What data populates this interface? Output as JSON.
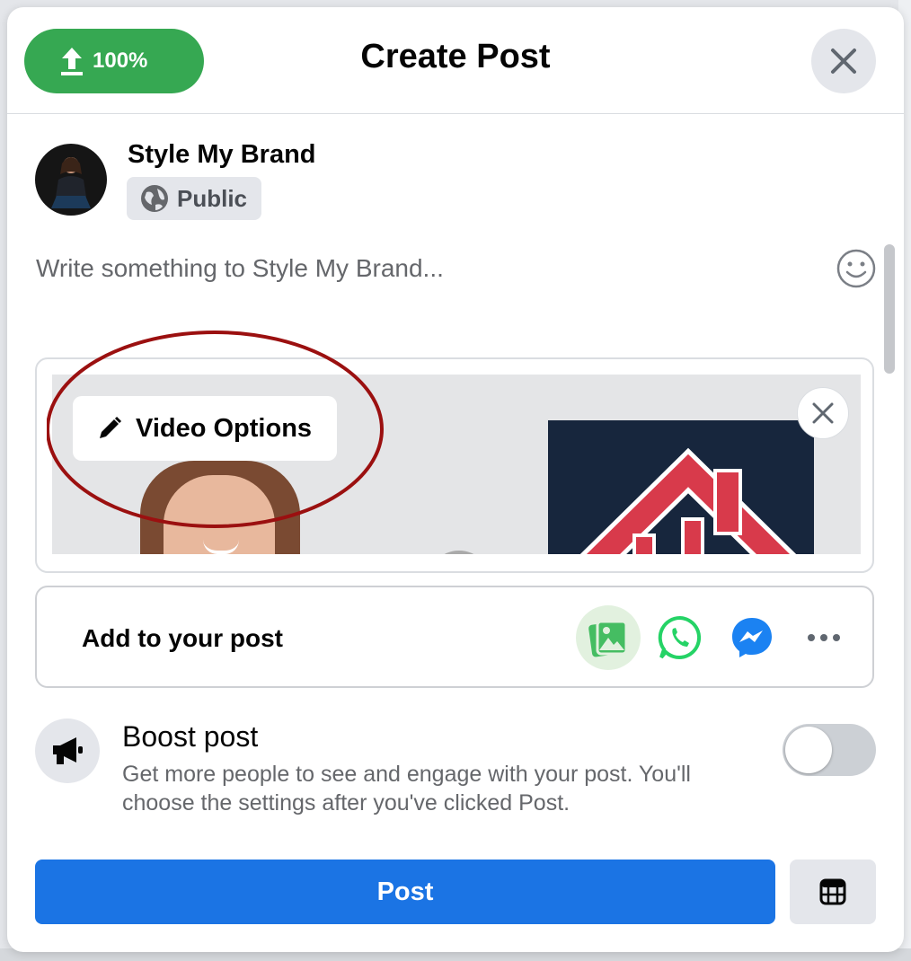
{
  "header": {
    "upload_progress": "100%",
    "title": "Create Post"
  },
  "author": {
    "name": "Style My Brand",
    "audience": "Public"
  },
  "composer": {
    "placeholder": "Write something to Style My Brand..."
  },
  "media": {
    "video_options_label": "Video Options"
  },
  "add_to_post": {
    "label": "Add to your post",
    "icons": [
      "photo-video-icon",
      "whatsapp-icon",
      "messenger-icon",
      "more-icon"
    ]
  },
  "boost": {
    "title": "Boost post",
    "description": "Get more people to see and engage with your post. You'll choose the settings after you've clicked Post.",
    "enabled": false
  },
  "actions": {
    "post_label": "Post"
  },
  "colors": {
    "upload_green": "#36a852",
    "post_blue": "#1b74e4",
    "annotation_red": "#9b1010"
  }
}
